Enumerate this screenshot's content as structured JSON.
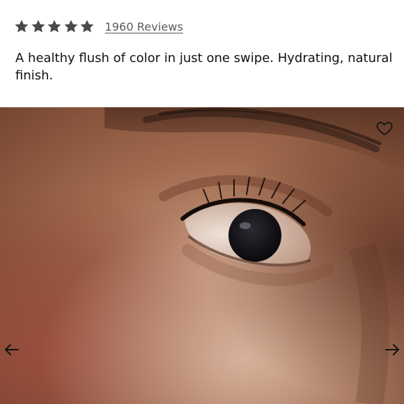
{
  "rating": {
    "stars": 5,
    "reviews_label": "1960 Reviews",
    "star_color": "#4a4a4a"
  },
  "product": {
    "description": "A healthy flush of color in just one swipe. Hydrating, natural finish."
  },
  "gallery": {
    "image_icon": "eye-closeup-photo",
    "wishlist_icon": "heart-outline-icon",
    "prev_icon": "arrow-left-icon",
    "next_icon": "arrow-right-icon"
  }
}
